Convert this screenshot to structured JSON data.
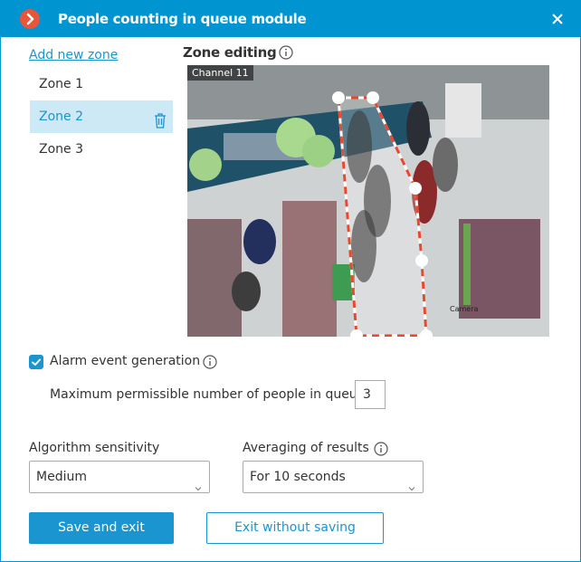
{
  "window": {
    "title": "People counting in queue module",
    "close_icon": "close-icon",
    "logo_icon": "chevron-right-logo-icon",
    "accent_color": "#0095d0",
    "logo_color": "#e8553a"
  },
  "zones": {
    "add_label": "Add new zone",
    "items": [
      {
        "label": "Zone 1",
        "selected": false
      },
      {
        "label": "Zone 2",
        "selected": true
      },
      {
        "label": "Zone 3",
        "selected": false
      }
    ],
    "delete_icon": "trash-icon"
  },
  "zone_editing": {
    "title": "Zone editing",
    "info_icon": "info-icon",
    "video": {
      "channel_label": "Channel 11",
      "camera_watermark": "Camera",
      "zone_outline_color": "#e8492e"
    }
  },
  "alarm": {
    "checked": true,
    "label": "Alarm event generation",
    "info_icon": "info-icon",
    "max_people_label": "Maximum permissible number of people in queue",
    "max_people_value": "3"
  },
  "sensitivity": {
    "label": "Algorithm sensitivity",
    "value": "Medium"
  },
  "averaging": {
    "label": "Averaging of results",
    "value": "For 10 seconds",
    "info_icon": "info-icon"
  },
  "buttons": {
    "save": "Save and exit",
    "cancel": "Exit without saving"
  }
}
